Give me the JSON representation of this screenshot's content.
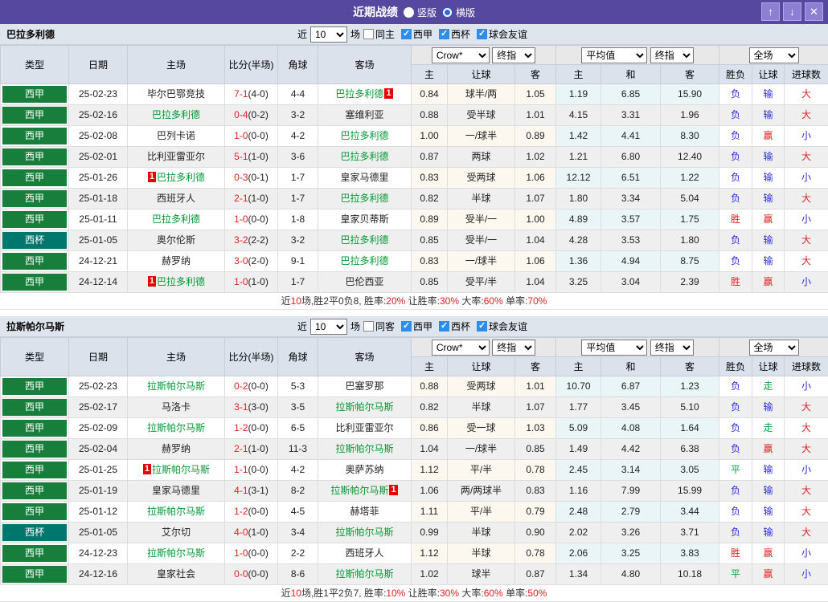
{
  "titlebar": {
    "title": "近期战绩",
    "radio_vertical": "竖版",
    "radio_horizontal": "横版",
    "selected": "横版",
    "buttons": {
      "up": "↑",
      "down": "↓",
      "close": "✕"
    }
  },
  "colors": {
    "titlebar_purple": "#55489E",
    "league_green": "#177E3B",
    "cup_teal": "#00776D",
    "focus_team_green": "#009933",
    "score_red": "#E02020",
    "lose_blue": "#2A2ADF",
    "draw_green": "#0FA045"
  },
  "columns": {
    "type": "类型",
    "date": "日期",
    "home": "主场",
    "score": "比分(半场)",
    "corner": "角球",
    "away": "客场",
    "odds_home": "主",
    "odds_handicap": "让球",
    "odds_away": "客",
    "avg_home": "主",
    "avg_draw": "和",
    "avg_away": "客",
    "result": "胜负",
    "handicap_result": "让球",
    "goals": "进球数"
  },
  "selects": {
    "company": "Crow*",
    "stage": "终指",
    "average": "平均值",
    "stage2": "终指",
    "scope": "全场",
    "count": "10"
  },
  "sections": [
    {
      "team": "巴拉多利德",
      "filter": {
        "recent_label": "近",
        "count": "10",
        "matches_label": "场",
        "same_label": "同主",
        "league_label": "西甲",
        "cup_label": "西杯",
        "friendly_label": "球会友谊"
      },
      "rows": [
        {
          "type": "西甲",
          "date": "25-02-23",
          "home": "毕尔巴鄂竞技",
          "home_team": false,
          "home_badge": "",
          "score": "7-1",
          "half": "(4-0)",
          "corner": "4-4",
          "away": "巴拉多利德",
          "away_team": true,
          "away_badge": "1",
          "o1": "0.84",
          "o2": "球半/两",
          "o3": "1.05",
          "a1": "1.19",
          "a2": "6.85",
          "a3": "15.90",
          "r1": "负",
          "r2": "输",
          "r3": "大"
        },
        {
          "type": "西甲",
          "date": "25-02-16",
          "home": "巴拉多利德",
          "home_team": true,
          "home_badge": "",
          "score": "0-4",
          "half": "(0-2)",
          "corner": "3-2",
          "away": "塞维利亚",
          "away_team": false,
          "away_badge": "",
          "o1": "0.88",
          "o2": "受半球",
          "o3": "1.01",
          "a1": "4.15",
          "a2": "3.31",
          "a3": "1.96",
          "r1": "负",
          "r2": "输",
          "r3": "大"
        },
        {
          "type": "西甲",
          "date": "25-02-08",
          "home": "巴列卡诺",
          "home_team": false,
          "home_badge": "",
          "score": "1-0",
          "half": "(0-0)",
          "corner": "4-2",
          "away": "巴拉多利德",
          "away_team": true,
          "away_badge": "",
          "o1": "1.00",
          "o2": "一/球半",
          "o3": "0.89",
          "a1": "1.42",
          "a2": "4.41",
          "a3": "8.30",
          "r1": "负",
          "r2": "赢",
          "r3": "小"
        },
        {
          "type": "西甲",
          "date": "25-02-01",
          "home": "比利亚雷亚尔",
          "home_team": false,
          "home_badge": "",
          "score": "5-1",
          "half": "(1-0)",
          "corner": "3-6",
          "away": "巴拉多利德",
          "away_team": true,
          "away_badge": "",
          "o1": "0.87",
          "o2": "两球",
          "o3": "1.02",
          "a1": "1.21",
          "a2": "6.80",
          "a3": "12.40",
          "r1": "负",
          "r2": "输",
          "r3": "大"
        },
        {
          "type": "西甲",
          "date": "25-01-26",
          "home": "巴拉多利德",
          "home_team": true,
          "home_badge": "1",
          "score": "0-3",
          "half": "(0-1)",
          "corner": "1-7",
          "away": "皇家马德里",
          "away_team": false,
          "away_badge": "",
          "o1": "0.83",
          "o2": "受两球",
          "o3": "1.06",
          "a1": "12.12",
          "a2": "6.51",
          "a3": "1.22",
          "r1": "负",
          "r2": "输",
          "r3": "小"
        },
        {
          "type": "西甲",
          "date": "25-01-18",
          "home": "西班牙人",
          "home_team": false,
          "home_badge": "",
          "score": "2-1",
          "half": "(1-0)",
          "corner": "1-7",
          "away": "巴拉多利德",
          "away_team": true,
          "away_badge": "",
          "o1": "0.82",
          "o2": "半球",
          "o3": "1.07",
          "a1": "1.80",
          "a2": "3.34",
          "a3": "5.04",
          "r1": "负",
          "r2": "输",
          "r3": "大"
        },
        {
          "type": "西甲",
          "date": "25-01-11",
          "home": "巴拉多利德",
          "home_team": true,
          "home_badge": "",
          "score": "1-0",
          "half": "(0-0)",
          "corner": "1-8",
          "away": "皇家贝蒂斯",
          "away_team": false,
          "away_badge": "",
          "o1": "0.89",
          "o2": "受半/一",
          "o3": "1.00",
          "a1": "4.89",
          "a2": "3.57",
          "a3": "1.75",
          "r1": "胜",
          "r2": "赢",
          "r3": "小"
        },
        {
          "type": "西杯",
          "date": "25-01-05",
          "home": "奥尔伦斯",
          "home_team": false,
          "home_badge": "",
          "score": "3-2",
          "half": "(2-2)",
          "corner": "3-2",
          "away": "巴拉多利德",
          "away_team": true,
          "away_badge": "",
          "o1": "0.85",
          "o2": "受半/一",
          "o3": "1.04",
          "a1": "4.28",
          "a2": "3.53",
          "a3": "1.80",
          "r1": "负",
          "r2": "输",
          "r3": "大"
        },
        {
          "type": "西甲",
          "date": "24-12-21",
          "home": "赫罗纳",
          "home_team": false,
          "home_badge": "",
          "score": "3-0",
          "half": "(2-0)",
          "corner": "9-1",
          "away": "巴拉多利德",
          "away_team": true,
          "away_badge": "",
          "o1": "0.83",
          "o2": "一/球半",
          "o3": "1.06",
          "a1": "1.36",
          "a2": "4.94",
          "a3": "8.75",
          "r1": "负",
          "r2": "输",
          "r3": "大"
        },
        {
          "type": "西甲",
          "date": "24-12-14",
          "home": "巴拉多利德",
          "home_team": true,
          "home_badge": "1",
          "score": "1-0",
          "half": "(1-0)",
          "corner": "1-7",
          "away": "巴伦西亚",
          "away_team": false,
          "away_badge": "",
          "o1": "0.85",
          "o2": "受平/半",
          "o3": "1.04",
          "a1": "3.25",
          "a2": "3.04",
          "a3": "2.39",
          "r1": "胜",
          "r2": "赢",
          "r3": "小"
        }
      ],
      "summary": {
        "s0": "近",
        "s1": "10",
        "s2": "场,胜2平0负8, 胜率:",
        "s3": "20%",
        "s4": " 让胜率:",
        "s5": "30%",
        "s6": " 大率:",
        "s7": "60%",
        "s8": " 单率:",
        "s9": "70%"
      }
    },
    {
      "team": "拉斯帕尔马斯",
      "filter": {
        "recent_label": "近",
        "count": "10",
        "matches_label": "场",
        "same_label": "同客",
        "league_label": "西甲",
        "cup_label": "西杯",
        "friendly_label": "球会友谊"
      },
      "rows": [
        {
          "type": "西甲",
          "date": "25-02-23",
          "home": "拉斯帕尔马斯",
          "home_team": true,
          "home_badge": "",
          "score": "0-2",
          "half": "(0-0)",
          "corner": "5-3",
          "away": "巴塞罗那",
          "away_team": false,
          "away_badge": "",
          "o1": "0.88",
          "o2": "受两球",
          "o3": "1.01",
          "a1": "10.70",
          "a2": "6.87",
          "a3": "1.23",
          "r1": "负",
          "r2": "走",
          "r3": "小"
        },
        {
          "type": "西甲",
          "date": "25-02-17",
          "home": "马洛卡",
          "home_team": false,
          "home_badge": "",
          "score": "3-1",
          "half": "(3-0)",
          "corner": "3-5",
          "away": "拉斯帕尔马斯",
          "away_team": true,
          "away_badge": "",
          "o1": "0.82",
          "o2": "半球",
          "o3": "1.07",
          "a1": "1.77",
          "a2": "3.45",
          "a3": "5.10",
          "r1": "负",
          "r2": "输",
          "r3": "大"
        },
        {
          "type": "西甲",
          "date": "25-02-09",
          "home": "拉斯帕尔马斯",
          "home_team": true,
          "home_badge": "",
          "score": "1-2",
          "half": "(0-0)",
          "corner": "6-5",
          "away": "比利亚雷亚尔",
          "away_team": false,
          "away_badge": "",
          "o1": "0.86",
          "o2": "受一球",
          "o3": "1.03",
          "a1": "5.09",
          "a2": "4.08",
          "a3": "1.64",
          "r1": "负",
          "r2": "走",
          "r3": "大"
        },
        {
          "type": "西甲",
          "date": "25-02-04",
          "home": "赫罗纳",
          "home_team": false,
          "home_badge": "",
          "score": "2-1",
          "half": "(1-0)",
          "corner": "11-3",
          "away": "拉斯帕尔马斯",
          "away_team": true,
          "away_badge": "",
          "o1": "1.04",
          "o2": "一/球半",
          "o3": "0.85",
          "a1": "1.49",
          "a2": "4.42",
          "a3": "6.38",
          "r1": "负",
          "r2": "赢",
          "r3": "大"
        },
        {
          "type": "西甲",
          "date": "25-01-25",
          "home": "拉斯帕尔马斯",
          "home_team": true,
          "home_badge": "1",
          "score": "1-1",
          "half": "(0-0)",
          "corner": "4-2",
          "away": "奥萨苏纳",
          "away_team": false,
          "away_badge": "",
          "o1": "1.12",
          "o2": "平/半",
          "o3": "0.78",
          "a1": "2.45",
          "a2": "3.14",
          "a3": "3.05",
          "r1": "平",
          "r2": "输",
          "r3": "小"
        },
        {
          "type": "西甲",
          "date": "25-01-19",
          "home": "皇家马德里",
          "home_team": false,
          "home_badge": "",
          "score": "4-1",
          "half": "(3-1)",
          "corner": "8-2",
          "away": "拉斯帕尔马斯",
          "away_team": true,
          "away_badge": "1",
          "o1": "1.06",
          "o2": "两/两球半",
          "o3": "0.83",
          "a1": "1.16",
          "a2": "7.99",
          "a3": "15.99",
          "r1": "负",
          "r2": "输",
          "r3": "大"
        },
        {
          "type": "西甲",
          "date": "25-01-12",
          "home": "拉斯帕尔马斯",
          "home_team": true,
          "home_badge": "",
          "score": "1-2",
          "half": "(0-0)",
          "corner": "4-5",
          "away": "赫塔菲",
          "away_team": false,
          "away_badge": "",
          "o1": "1.11",
          "o2": "平/半",
          "o3": "0.79",
          "a1": "2.48",
          "a2": "2.79",
          "a3": "3.44",
          "r1": "负",
          "r2": "输",
          "r3": "大"
        },
        {
          "type": "西杯",
          "date": "25-01-05",
          "home": "艾尔切",
          "home_team": false,
          "home_badge": "",
          "score": "4-0",
          "half": "(1-0)",
          "corner": "3-4",
          "away": "拉斯帕尔马斯",
          "away_team": true,
          "away_badge": "",
          "o1": "0.99",
          "o2": "半球",
          "o3": "0.90",
          "a1": "2.02",
          "a2": "3.26",
          "a3": "3.71",
          "r1": "负",
          "r2": "输",
          "r3": "大"
        },
        {
          "type": "西甲",
          "date": "24-12-23",
          "home": "拉斯帕尔马斯",
          "home_team": true,
          "home_badge": "",
          "score": "1-0",
          "half": "(0-0)",
          "corner": "2-2",
          "away": "西班牙人",
          "away_team": false,
          "away_badge": "",
          "o1": "1.12",
          "o2": "半球",
          "o3": "0.78",
          "a1": "2.06",
          "a2": "3.25",
          "a3": "3.83",
          "r1": "胜",
          "r2": "赢",
          "r3": "小"
        },
        {
          "type": "西甲",
          "date": "24-12-16",
          "home": "皇家社会",
          "home_team": false,
          "home_badge": "",
          "score": "0-0",
          "half": "(0-0)",
          "corner": "8-6",
          "away": "拉斯帕尔马斯",
          "away_team": true,
          "away_badge": "",
          "o1": "1.02",
          "o2": "球半",
          "o3": "0.87",
          "a1": "1.34",
          "a2": "4.80",
          "a3": "10.18",
          "r1": "平",
          "r2": "赢",
          "r3": "小"
        }
      ],
      "summary": {
        "s0": "近",
        "s1": "10",
        "s2": "场,胜1平2负7, 胜率:",
        "s3": "10%",
        "s4": " 让胜率:",
        "s5": "30%",
        "s6": " 大率:",
        "s7": "60%",
        "s8": " 单率:",
        "s9": "50%"
      }
    }
  ]
}
